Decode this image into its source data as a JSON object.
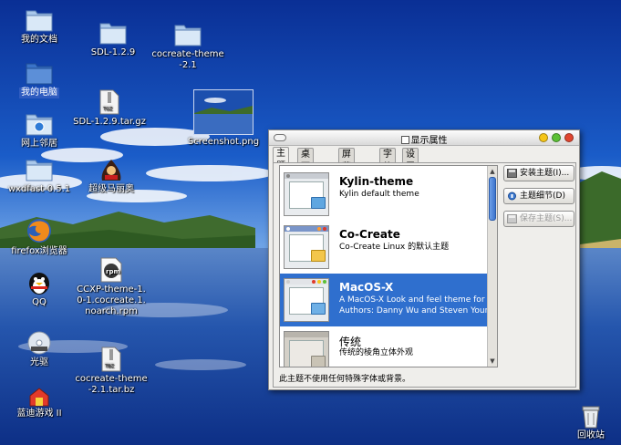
{
  "desktop": {
    "icons": [
      {
        "label": "我的文档",
        "icon": "folder-icon"
      },
      {
        "label": "我的电脑",
        "icon": "computer-folder-icon"
      },
      {
        "label": "网上邻居",
        "icon": "network-folder-icon"
      },
      {
        "label": "wxdfast-0.5.1",
        "icon": "folder-icon"
      },
      {
        "label": "firefox浏览器",
        "icon": "firefox-icon"
      },
      {
        "label": "QQ",
        "icon": "qq-penguin-icon"
      },
      {
        "label": "光驱",
        "icon": "cdrom-icon"
      },
      {
        "label": "蓝迪游戏 II",
        "icon": "game-house-icon"
      },
      {
        "label": "SDL-1.2.9",
        "icon": "folder-icon"
      },
      {
        "label": "SDL-1.2.9.tar.gz",
        "icon": "archive-file-icon"
      },
      {
        "label": "超级马丽奥",
        "icon": "mario-game-icon"
      },
      {
        "label": "CCXP-theme-1.0-1.cocreate.1.noarch.rpm",
        "icon": "rpm-package-icon"
      },
      {
        "label": "cocreate-theme-2.1.tar.bz",
        "icon": "archive-file-icon"
      },
      {
        "label": "cocreate-theme-2.1",
        "icon": "folder-icon"
      },
      {
        "label": "Screenshot.png",
        "icon": "image-thumbnail-icon"
      },
      {
        "label": "回收站",
        "icon": "trash-icon"
      }
    ]
  },
  "dialog": {
    "title": "显示属性",
    "tabs": [
      "主题",
      "桌面背景",
      "屏幕保护",
      "字体",
      "设置"
    ],
    "active_tab": "主题",
    "themes": [
      {
        "name": "Kylin-theme",
        "desc1": "Kylin default theme",
        "desc2": ""
      },
      {
        "name": "Co-Create",
        "desc1": "Co-Create Linux 的默认主题",
        "desc2": ""
      },
      {
        "name": "MacOS-X",
        "desc1": "A MacOS-X Look and feel theme for",
        "desc2": "Authors: Danny Wu and Steven Young"
      },
      {
        "name": "传统",
        "desc1": "传统的棱角立体外观",
        "desc2": ""
      }
    ],
    "selected_theme": "MacOS-X",
    "buttons": {
      "install": "安装主题(I)...",
      "details": "主题细节(D)",
      "save": "保存主题(S)..."
    },
    "status_text": "此主题不使用任何特殊字体或背景。",
    "colors": {
      "selection": "#2f6fce",
      "scroll_thumb": "#3d74cc"
    }
  }
}
